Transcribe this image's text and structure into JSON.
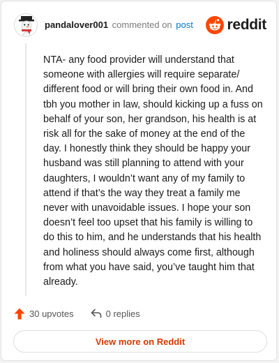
{
  "comment": {
    "author": "pandalover001",
    "action_text": "commented on",
    "post_link_text": "post",
    "body": "NTA- any food provider will understand that someone with allergies will require separate/ different food or will bring their own food in. And tbh you mother in law, should kicking up a fuss on behalf of your son, her grandson, his health is at risk all for the sake of money at the end of the day. I honestly think they should be happy your husband was still planning to attend with your daughters, I wouldn’t want any of my family to attend if that’s the way they treat a family me never with unavoidable issues. I hope your son doesn’t feel too upset that his family is willing to do this to him, and he understands that his health and holiness should always come first, although from what you have said, you’ve taught him that already.",
    "upvotes_label": "30 upvotes",
    "replies_label": "0 replies"
  },
  "brand": {
    "name": "reddit",
    "logo_icon": "reddit-snoo-icon",
    "color": "#ff4500"
  },
  "footer": {
    "view_more_label": "View more on Reddit"
  },
  "colors": {
    "accent": "#ff4500",
    "link": "#0079d3",
    "cta_text": "#d93a00"
  }
}
